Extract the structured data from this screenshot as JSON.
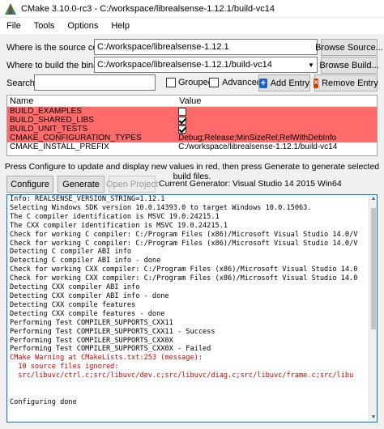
{
  "window": {
    "title": "CMake 3.10.0-rc3 - C:/workspace/librealsense-1.12.1/build-vc14"
  },
  "menu": [
    "File",
    "Tools",
    "Options",
    "Help"
  ],
  "source": {
    "label": "Where is the source code:",
    "value": "C:/workspace/librealsense-1.12.1",
    "browse_label": "Browse Source..."
  },
  "binaries": {
    "label": "Where to build the binaries:",
    "value": "C:/workspace/librealsense-1.12.1/build-vc14",
    "browse_label": "Browse Build..."
  },
  "search": {
    "label": "Search:",
    "value": "",
    "grouped_label": "Grouped",
    "advanced_label": "Advanced",
    "add_entry_label": "Add Entry",
    "remove_entry_label": "Remove Entry"
  },
  "table": {
    "headers": [
      "Name",
      "Value"
    ],
    "rows": [
      {
        "name": "BUILD_EXAMPLES",
        "type": "bool",
        "checked": false,
        "value": "",
        "highlight": true
      },
      {
        "name": "BUILD_SHARED_LIBS",
        "type": "bool",
        "checked": true,
        "value": "",
        "highlight": true
      },
      {
        "name": "BUILD_UNIT_TESTS",
        "type": "bool",
        "checked": true,
        "value": "",
        "highlight": true
      },
      {
        "name": "CMAKE_CONFIGURATION_TYPES",
        "type": "text",
        "checked": false,
        "value": "Debug;Release;MinSizeRel;RelWithDebInfo",
        "highlight": true
      },
      {
        "name": "CMAKE_INSTALL_PREFIX",
        "type": "text",
        "checked": false,
        "value": "C:/workspace/librealsense-1.12.1/build-vc14",
        "highlight": false
      }
    ]
  },
  "info": {
    "text": "Press Configure to update and display new values in red, then press Generate to generate selected build files."
  },
  "actions": {
    "configure_label": "Configure",
    "generate_label": "Generate",
    "open_project_label": "Open Project",
    "current_generator": "Current Generator: Visual Studio 14 2015 Win64"
  },
  "log": [
    {
      "text": "Info: REALSENSE_VERSION_STRING=1.12.1",
      "warn": false
    },
    {
      "text": "Selecting Windows SDK version 10.0.14393.0 to target Windows 10.0.15063.",
      "warn": false
    },
    {
      "text": "The C compiler identification is MSVC 19.0.24215.1",
      "warn": false
    },
    {
      "text": "The CXX compiler identification is MSVC 19.0.24215.1",
      "warn": false
    },
    {
      "text": "Check for working C compiler: C:/Program Files (x86)/Microsoft Visual Studio 14.0/V",
      "warn": false
    },
    {
      "text": "Check for working C compiler: C:/Program Files (x86)/Microsoft Visual Studio 14.0/V",
      "warn": false
    },
    {
      "text": "Detecting C compiler ABI info",
      "warn": false
    },
    {
      "text": "Detecting C compiler ABI info - done",
      "warn": false
    },
    {
      "text": "Check for working CXX compiler: C:/Program Files (x86)/Microsoft Visual Studio 14.0",
      "warn": false
    },
    {
      "text": "Check for working CXX compiler: C:/Program Files (x86)/Microsoft Visual Studio 14.0",
      "warn": false
    },
    {
      "text": "Detecting CXX compiler ABI info",
      "warn": false
    },
    {
      "text": "Detecting CXX compiler ABI info - done",
      "warn": false
    },
    {
      "text": "Detecting CXX compile features",
      "warn": false
    },
    {
      "text": "Detecting CXX compile features - done",
      "warn": false
    },
    {
      "text": "Performing Test COMPILER_SUPPORTS_CXX11",
      "warn": false
    },
    {
      "text": "Performing Test COMPILER_SUPPORTS_CXX11 - Success",
      "warn": false
    },
    {
      "text": "Performing Test COMPILER_SUPPORTS_CXX0X",
      "warn": false
    },
    {
      "text": "Performing Test COMPILER_SUPPORTS_CXX0X - Failed",
      "warn": false
    },
    {
      "text": "CMake Warning at CMakeLists.txt:253 (message):",
      "warn": true
    },
    {
      "text": "  10 source files ignored:",
      "warn": true
    },
    {
      "text": "  src/libuvc/ctrl.c;src/libuvc/dev.c;src/libuvc/diag.c;src/libuvc/frame.c;src/libu",
      "warn": true
    },
    {
      "text": "",
      "warn": false
    },
    {
      "text": "",
      "warn": false
    },
    {
      "text": "Configuring done",
      "warn": false
    }
  ]
}
